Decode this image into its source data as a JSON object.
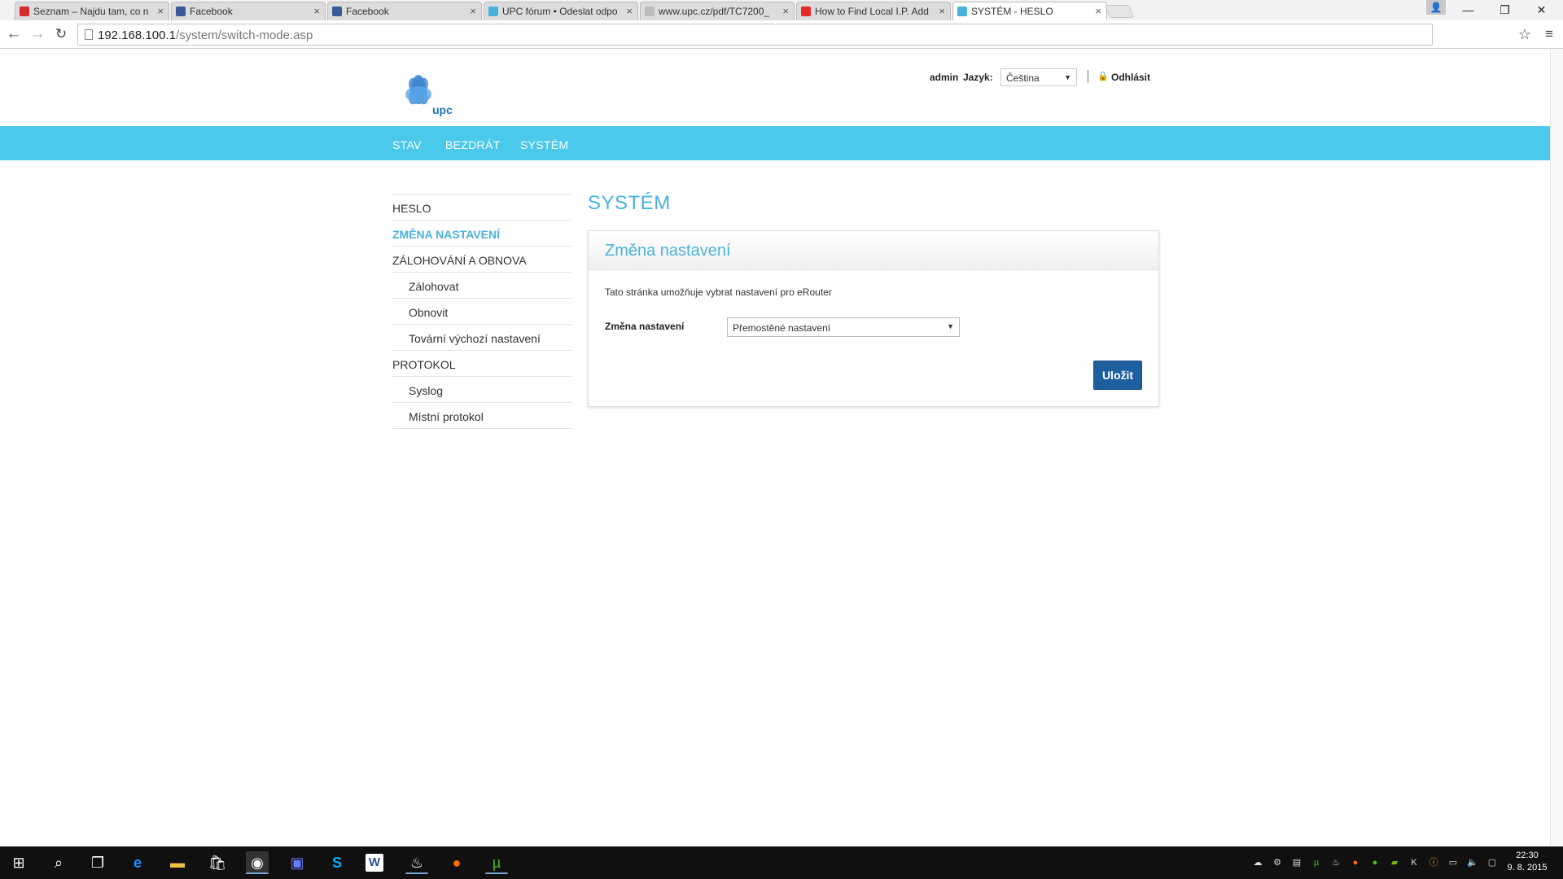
{
  "browser": {
    "tabs": [
      {
        "label": "Seznam – Najdu tam, co n",
        "favicon": "seznam-icon",
        "favicon_color": "#d62b2b"
      },
      {
        "label": "Facebook",
        "favicon": "facebook-icon",
        "favicon_color": "#3b5998"
      },
      {
        "label": "Facebook",
        "favicon": "facebook-icon",
        "favicon_color": "#3b5998"
      },
      {
        "label": "UPC fórum • Odeslat odpo",
        "favicon": "upc-icon",
        "favicon_color": "#4ab0dc"
      },
      {
        "label": "www.upc.cz/pdf/TC7200_",
        "favicon": "page-icon",
        "favicon_color": "#bbbbbb"
      },
      {
        "label": "How to Find Local I.P. Add",
        "favicon": "youtube-icon",
        "favicon_color": "#e52d27"
      },
      {
        "label": "SYSTÉM - HESLO",
        "favicon": "upc-icon",
        "favicon_color": "#4ab0dc"
      }
    ],
    "url_host": "192.168.100.1",
    "url_path": "/system/switch-mode.asp",
    "win_minimize": "—",
    "win_restore": "❐",
    "win_close": "✕"
  },
  "header": {
    "logo_text": "upc",
    "user": "admin",
    "language_label": "Jazyk:",
    "language_value": "Čeština",
    "logout": "Odhlásit"
  },
  "nav": [
    "STAV",
    "BEZDRÁT",
    "SYSTÉM"
  ],
  "sidebar": [
    {
      "label": "HESLO",
      "sub": false,
      "active": false
    },
    {
      "label": "ZMĚNA NASTAVENÍ",
      "sub": false,
      "active": true
    },
    {
      "label": "ZÁLOHOVÁNÍ A OBNOVA",
      "sub": false,
      "active": false
    },
    {
      "label": "Zálohovat",
      "sub": true,
      "active": false
    },
    {
      "label": "Obnovit",
      "sub": true,
      "active": false
    },
    {
      "label": "Tovární výchozí nastavení",
      "sub": true,
      "active": false
    },
    {
      "label": "PROTOKOL",
      "sub": false,
      "active": false
    },
    {
      "label": "Syslog",
      "sub": true,
      "active": false
    },
    {
      "label": "Místní protokol",
      "sub": true,
      "active": false
    }
  ],
  "main": {
    "page_title": "SYSTÉM",
    "panel_title": "Změna nastavení",
    "description": "Tato stránka umožňuje vybrat nastavení pro eRouter",
    "field_label": "Změna nastavení",
    "field_value": "Přemostěné nastavení",
    "save_label": "Uložit"
  },
  "taskbar": {
    "time": "22:30",
    "date": "9. 8. 2015"
  },
  "colors": {
    "accent": "#4ac9ea",
    "title": "#4ab0dc",
    "button": "#1e5fa0"
  }
}
